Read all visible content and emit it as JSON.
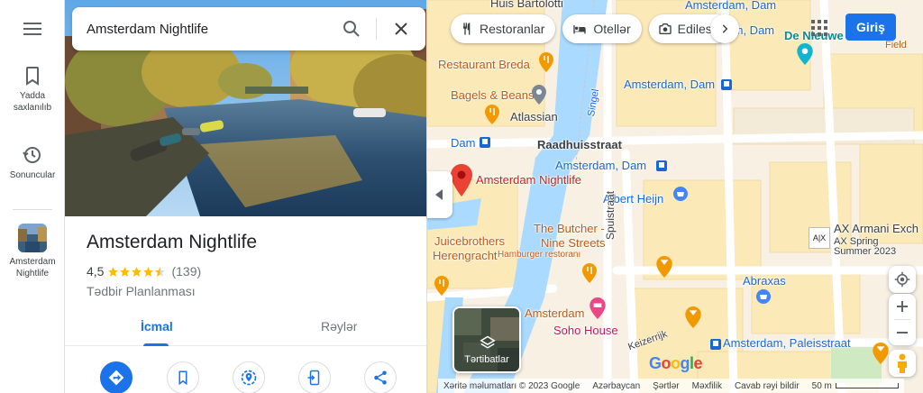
{
  "search": {
    "value": "Amsterdam Nightlife"
  },
  "rail": {
    "saved_label": "Yadda saxlanılıb",
    "recents_label": "Sonuncular",
    "recent_place_label": "Amsterdam Nightlife"
  },
  "place": {
    "title": "Amsterdam Nightlife",
    "rating": "4,5",
    "stars": 4.5,
    "reviews": "(139)",
    "category": "Tədbir Planlanması"
  },
  "tabs": [
    {
      "label": "İcmal"
    },
    {
      "label": "Rəylər"
    }
  ],
  "map": {
    "chips": [
      {
        "label": "Restoranlar",
        "icon": "restaurant-icon"
      },
      {
        "label": "Otellər",
        "icon": "hotel-icon"
      },
      {
        "label": "Edilesi",
        "icon": "camera-icon"
      }
    ],
    "signin_label": "Giriş",
    "layers_label": "Tərtibatlar",
    "labels": {
      "bartoloti": "Huis Bartolotti",
      "dam_top": "Amsterdam, Dam",
      "dam_top2": "Amsterdam, Dam",
      "nieuwe_kerk": "De Nieuwe",
      "field": "Field",
      "breda": "Restaurant Breda",
      "bagels": "Bagels & Beans",
      "atlassian": "Atlassian",
      "dam_mid": "Amsterdam, Dam",
      "dam_left": "Dam",
      "raadhuis": "Raadhuisstraat",
      "dam_center": "Amsterdam, Dam",
      "nightlife": "Amsterdam Nightlife",
      "albert": "Albert Heijn",
      "juice": "Juicebrothers",
      "herengracht": "Herengracht",
      "butcher1": "The Butcher -",
      "butcher2": "Nine Streets",
      "hamburger": "Hamburger restoranı",
      "spui": "Spuistraat",
      "singel": "Singel",
      "armani1": "AX Armani Exch",
      "armani2": "AX Spring",
      "armani3": "Summer 2023",
      "abraxas": "Abraxas",
      "soho": "Soho House",
      "dam_bottom": "Amsterdam",
      "paleis": "Amsterdam, Paleisstraat",
      "keizerrijk": "Keizerrijk"
    },
    "footer": {
      "data": "Xəritə məlumatları © 2023 Google",
      "country": "Azərbaycan",
      "terms": "Şərtlər",
      "privacy": "Məxfilik",
      "feedback": "Cavab rəyi bildir",
      "scale": "50 m"
    },
    "google": "Google"
  },
  "colors": {
    "accent": "#1a73e8",
    "map_bg": "#f8f1e3",
    "water": "#aadaff",
    "pin": "#ea4335"
  }
}
